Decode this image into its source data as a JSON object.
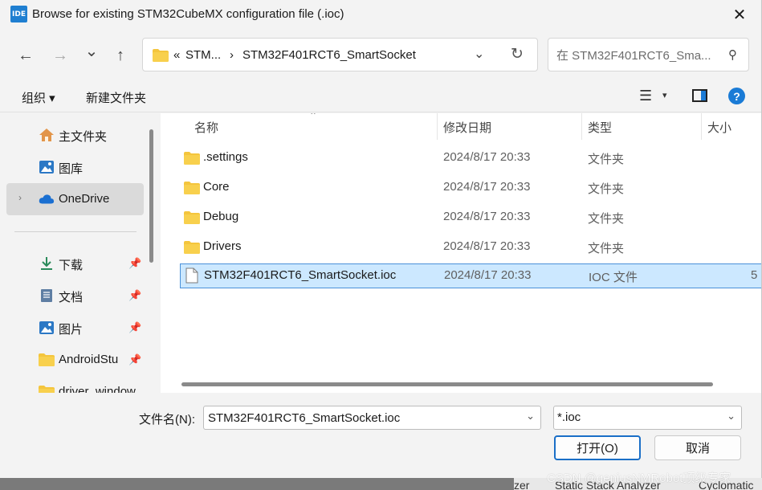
{
  "window": {
    "icon_text": "IDE",
    "title": "Browse for existing STM32CubeMX configuration file (.ioc)",
    "close_glyph": "✕"
  },
  "nav": {
    "back_glyph": "←",
    "forward_glyph": "→",
    "recent_glyph": "⌄",
    "up_glyph": "↑"
  },
  "address": {
    "overflow": "«",
    "segment1": "STM...",
    "separator": "›",
    "segment2": "STM32F401RCT6_SmartSocket",
    "chevron_glyph": "⌄",
    "refresh_glyph": "↻"
  },
  "search": {
    "placeholder": "在 STM32F401RCT6_Sma...",
    "icon_glyph": "⚲"
  },
  "toolbar": {
    "organize": "组织 ▾",
    "new_folder": "新建文件夹",
    "view_glyph": "☰",
    "view_dropdown_glyph": "▾",
    "help_glyph": "?"
  },
  "sidebar": {
    "items": [
      {
        "label": "主文件夹",
        "icon": "home-icon"
      },
      {
        "label": "图库",
        "icon": "gallery-icon"
      },
      {
        "label": "OneDrive",
        "icon": "cloud-icon",
        "selected": true
      },
      {
        "label": "下载",
        "icon": "download-icon",
        "pinned": true
      },
      {
        "label": "文档",
        "icon": "document-icon",
        "pinned": true
      },
      {
        "label": "图片",
        "icon": "pictures-icon",
        "pinned": true
      },
      {
        "label": "AndroidStu",
        "icon": "folder-icon",
        "pinned": true
      },
      {
        "label": "driver_window",
        "icon": "folder-icon"
      }
    ],
    "expander_glyph": "›",
    "pin_glyph": "📌"
  },
  "columns": {
    "name": "名称",
    "date": "修改日期",
    "type": "类型",
    "size": "大小",
    "sort_glyph": "⌃"
  },
  "files": [
    {
      "name": ".settings",
      "date": "2024/8/17 20:33",
      "type": "文件夹",
      "size": "",
      "kind": "folder"
    },
    {
      "name": "Core",
      "date": "2024/8/17 20:33",
      "type": "文件夹",
      "size": "",
      "kind": "folder"
    },
    {
      "name": "Debug",
      "date": "2024/8/17 20:33",
      "type": "文件夹",
      "size": "",
      "kind": "folder"
    },
    {
      "name": "Drivers",
      "date": "2024/8/17 20:33",
      "type": "文件夹",
      "size": "",
      "kind": "folder"
    },
    {
      "name": "STM32F401RCT6_SmartSocket.ioc",
      "date": "2024/8/17 20:33",
      "type": "IOC 文件",
      "size": "5",
      "kind": "file",
      "selected": true
    }
  ],
  "bottom": {
    "filename_label": "文件名(N):",
    "filename_value": "STM32F401RCT6_SmartSocket.ioc",
    "filter_value": "*.ioc",
    "combo_glyph": "⌄",
    "open_button": "打开(O)",
    "cancel_button": "取消"
  },
  "background": {
    "item1": "zer",
    "item2": "Static Stack Analyzer",
    "item3": "Cyclomatic",
    "watermark": "CSDN @geniusNMRobot顶级专家"
  },
  "colors": {
    "accent": "#1a7bd6",
    "selection": "#cce8ff",
    "folder": "#f4c53d"
  }
}
